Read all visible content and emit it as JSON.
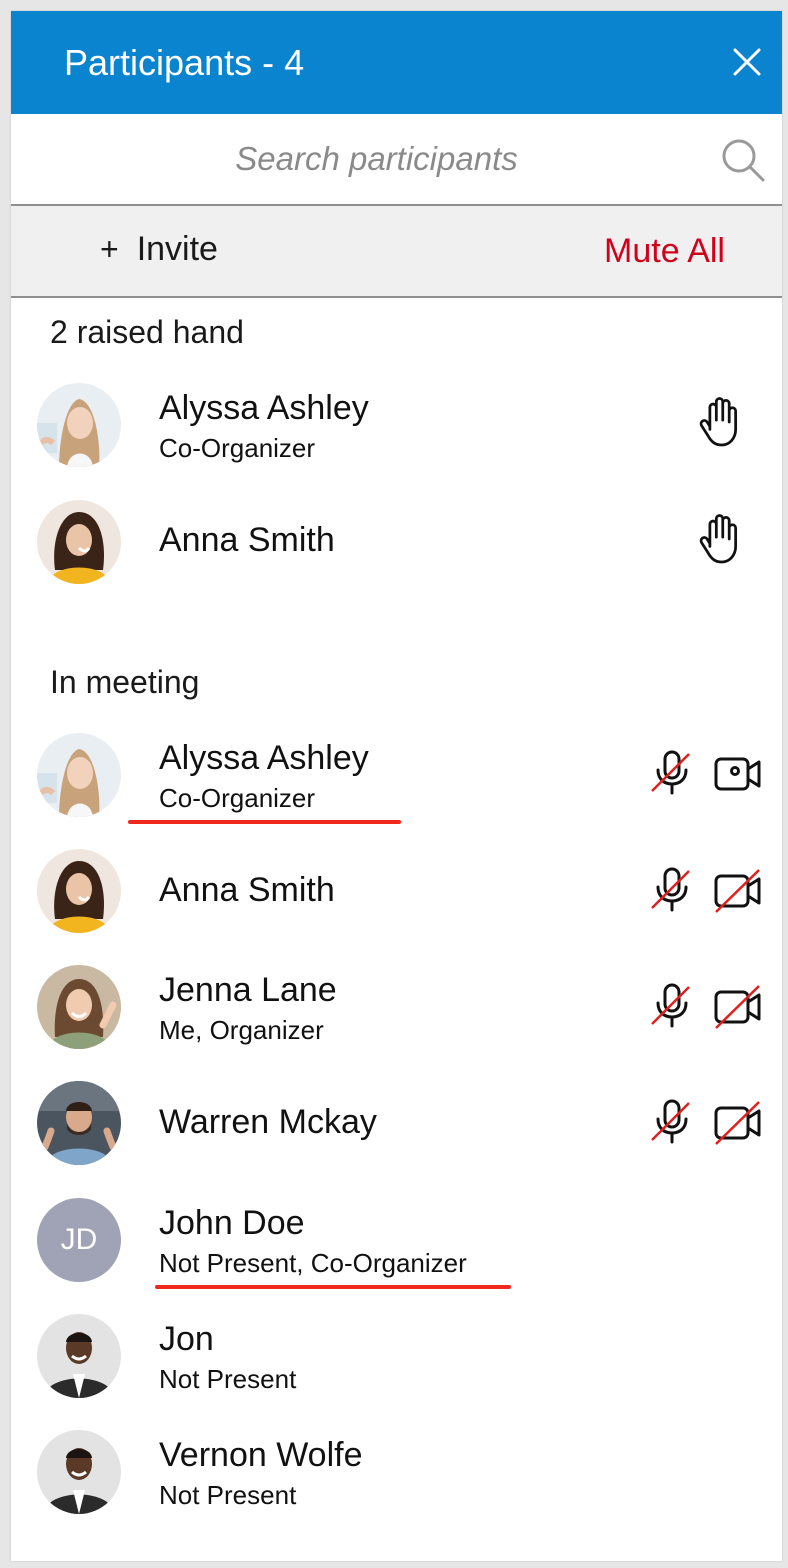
{
  "header": {
    "title": "Participants - 4"
  },
  "search": {
    "placeholder": "Search participants"
  },
  "actions": {
    "invite_label": "Invite",
    "invite_symbol": "+",
    "mute_all_label": "Mute All"
  },
  "colors": {
    "header_bg": "#0a84cf",
    "mute_all": "#d0021b",
    "annotation_underline": "#f0281e",
    "initials_avatar": "#a0a3b5"
  },
  "raised_hand": {
    "title": "2 raised hand",
    "participants": [
      {
        "name": "Alyssa Ashley",
        "role": "Co-Organizer",
        "icon": "raised-hand-icon"
      },
      {
        "name": "Anna Smith",
        "role": "",
        "icon": "raised-hand-icon"
      }
    ]
  },
  "in_meeting": {
    "title": "In meeting",
    "participants": [
      {
        "name": "Alyssa Ashley",
        "role": "Co-Organizer",
        "mic": "muted",
        "camera": "on"
      },
      {
        "name": "Anna Smith",
        "role": "",
        "mic": "muted",
        "camera": "off"
      },
      {
        "name": "Jenna Lane",
        "role": "Me, Organizer",
        "mic": "muted",
        "camera": "off"
      },
      {
        "name": "Warren Mckay",
        "role": "",
        "mic": "muted",
        "camera": "off"
      },
      {
        "name": "John Doe",
        "initials": "JD",
        "role": "Not Present, Co-Organizer"
      },
      {
        "name": "Jon",
        "role": "Not Present"
      },
      {
        "name": "Vernon Wolfe",
        "role": "Not Present"
      }
    ]
  }
}
